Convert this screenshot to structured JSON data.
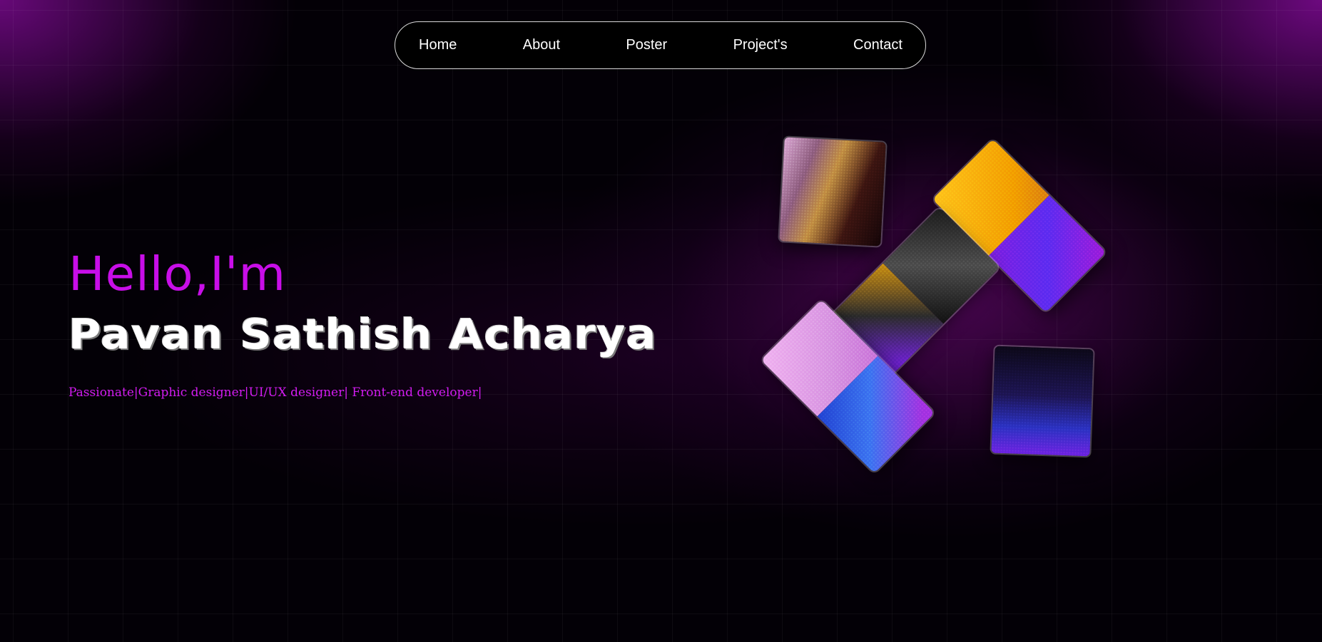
{
  "nav": {
    "items": [
      {
        "label": "Home"
      },
      {
        "label": "About"
      },
      {
        "label": "Poster"
      },
      {
        "label": "Project's"
      },
      {
        "label": "Contact"
      }
    ]
  },
  "hero": {
    "greeting": "Hello,I'm",
    "name": "Pavan Sathish Acharya",
    "tagline": "Passionate|Graphic designer|UI/UX designer| Front-end developer|"
  },
  "colors": {
    "accent": "#c80ee8",
    "background": "#030006",
    "nav_border": "#d9d9d9"
  }
}
